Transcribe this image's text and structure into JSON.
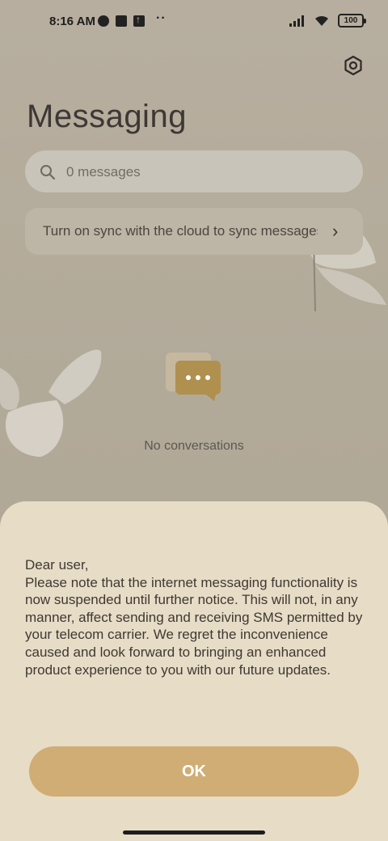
{
  "status_bar": {
    "time": "8:16 AM",
    "battery": "100",
    "icons": [
      "app-notification-icon",
      "square-app-icon",
      "upload-icon",
      "more-dots",
      "signal-icon",
      "wifi-icon",
      "battery-icon"
    ]
  },
  "header": {
    "title": "Messaging",
    "settings_icon": "gear-icon"
  },
  "search": {
    "placeholder": "0 messages"
  },
  "sync_banner": {
    "text": "Turn on sync with the cloud to sync messages"
  },
  "empty_state": {
    "icon": "chat-bubble-icon",
    "text": "No conversations"
  },
  "dialog": {
    "message": "Dear user,\nPlease note that the internet messaging functionality is now suspended until further notice. This will not, in any manner, affect sending and receiving SMS permitted by your telecom carrier. We regret the inconvenience caused and look forward to bringing an enhanced product experience to you with our future updates.",
    "ok_label": "OK"
  },
  "colors": {
    "accent": "#cfad75",
    "sheet_bg": "#e7dcc6",
    "screen_bg": "#b2aa99"
  }
}
